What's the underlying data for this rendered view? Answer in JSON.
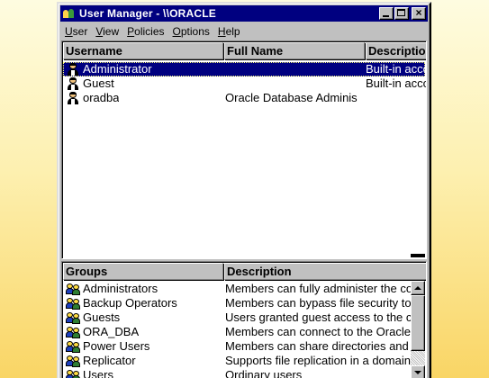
{
  "window": {
    "title": "User Manager - \\\\ORACLE"
  },
  "menu": [
    {
      "label": "User",
      "accel": "U",
      "rest": "ser"
    },
    {
      "label": "View",
      "accel": "V",
      "rest": "iew"
    },
    {
      "label": "Policies",
      "accel": "P",
      "rest": "olicies"
    },
    {
      "label": "Options",
      "accel": "O",
      "rest": "ptions"
    },
    {
      "label": "Help",
      "accel": "H",
      "rest": "elp"
    }
  ],
  "users": {
    "columns": [
      "Username",
      "Full Name",
      "Descriptio"
    ],
    "rows": [
      {
        "username": "Administrator",
        "full_name": "",
        "description": "Built-in acco",
        "selected": true,
        "icon": "admin-user-icon"
      },
      {
        "username": "Guest",
        "full_name": "",
        "description": "Built-in acco",
        "selected": false,
        "icon": "guest-user-icon"
      },
      {
        "username": "oradba",
        "full_name": "Oracle Database Adminis",
        "description": "",
        "selected": false,
        "icon": "user-icon"
      }
    ]
  },
  "groups": {
    "columns": [
      "Groups",
      "Description"
    ],
    "rows": [
      {
        "name": "Administrators",
        "description": "Members can fully administer the co"
      },
      {
        "name": "Backup Operators",
        "description": "Members can bypass file security to"
      },
      {
        "name": "Guests",
        "description": "Users granted guest access to the c"
      },
      {
        "name": "ORA_DBA",
        "description": "Members can connect to the Oracle"
      },
      {
        "name": "Power Users",
        "description": "Members can share directories and"
      },
      {
        "name": "Replicator",
        "description": "Supports file replication in a domain"
      },
      {
        "name": "Users",
        "description": "Ordinary users"
      }
    ]
  },
  "colors": {
    "titlebar": "#000080",
    "selection": "#000080",
    "face": "#c0c0c0",
    "background_top": "#fefce0",
    "background_bottom": "#f9d565"
  }
}
